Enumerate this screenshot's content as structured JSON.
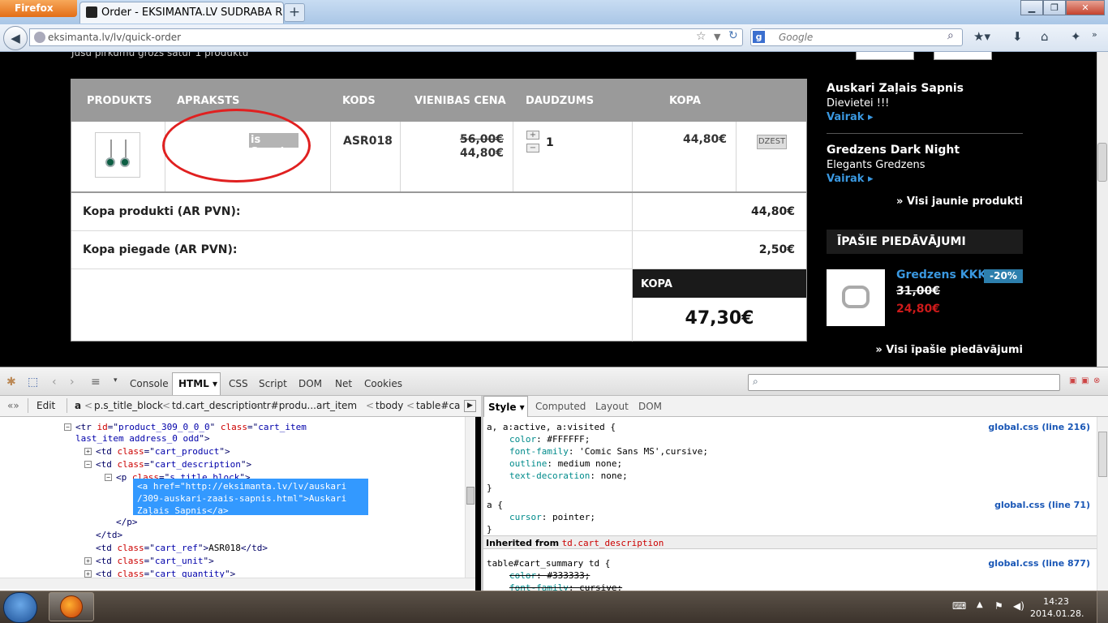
{
  "browser": {
    "menu_label": "Firefox",
    "tab_title": "Order - EKSIMANTA.LV SUDRABA ROTAS",
    "new_tab": "+",
    "url": "eksimanta.lv/lv/quick-order",
    "search_placeholder": "Google",
    "search_engine_badge": "g"
  },
  "page": {
    "top_message": "Jūsu pirkumu grozs satur 1 produktu",
    "cart": {
      "headers": [
        "PRODUKTS",
        "APRAKSTS",
        "KODS",
        "VIENIBAS CENA",
        "DAUDZUMS",
        "KOPA"
      ],
      "item": {
        "description_visible": "is Sapnis",
        "code": "ASR018",
        "old_price": "56,00€",
        "unit_price": "44,80€",
        "quantity": "1",
        "total": "44,80€",
        "delete_label": "DZEST",
        "plus": "+",
        "minus": "−"
      },
      "summary": [
        {
          "label": "Kopa produkti (AR PVN):",
          "value": "44,80€"
        },
        {
          "label": "Kopa piegade (AR PVN):",
          "value": "2,50€"
        }
      ],
      "grand_label": "KOPA",
      "grand_total": "47,30€"
    },
    "sidebar": {
      "products": [
        {
          "name": "Auskari Zaļais Sapnis",
          "desc": "Dievietei !!!",
          "more": "Vairak"
        },
        {
          "name": "Gredzens Dark Night",
          "desc": "Elegants Gredzens",
          "more": "Vairak"
        }
      ],
      "new_link": "» Visi jaunie produkti",
      "special_title": "ĪPAŠIE PIEDĀVĀJUMI",
      "special_item": {
        "name": "Gredzens KKK",
        "discount": "-20%",
        "old_price": "31,00€",
        "new_price": "24,80€"
      },
      "special_link": "» Visi īpašie piedāvājumi"
    }
  },
  "firebug": {
    "tabs": [
      "Console",
      "HTML",
      "CSS",
      "Script",
      "DOM",
      "Net",
      "Cookies"
    ],
    "edit_label": "Edit",
    "breadcrumb": [
      "a",
      "p.s_title_block",
      "td.cart_description",
      "tr#produ...art_item",
      "tbody",
      "table#ca"
    ],
    "html_lines": [
      {
        "indent": 93,
        "parts": [
          [
            "tg",
            "<tr "
          ],
          [
            "an",
            "id"
          ],
          [
            "tg",
            "=\""
          ],
          [
            "av",
            "product_309_0_0_0"
          ],
          [
            "tg",
            "\" "
          ],
          [
            "an",
            "class"
          ],
          [
            "tg",
            "=\""
          ],
          [
            "av",
            "cart_item"
          ]
        ]
      },
      {
        "indent": 93,
        "parts": [
          [
            "av",
            "last_item address_0 odd"
          ],
          [
            "tg",
            "\">"
          ]
        ]
      },
      {
        "indent": 118,
        "parts": [
          [
            "tg",
            "<td "
          ],
          [
            "an",
            "class"
          ],
          [
            "tg",
            "=\""
          ],
          [
            "av",
            "cart_product"
          ],
          [
            "tg",
            "\">"
          ]
        ]
      },
      {
        "indent": 118,
        "parts": [
          [
            "tg",
            "<td "
          ],
          [
            "an",
            "class"
          ],
          [
            "tg",
            "=\""
          ],
          [
            "av",
            "cart_description"
          ],
          [
            "tg",
            "\">"
          ]
        ]
      },
      {
        "indent": 143,
        "parts": [
          [
            "tg",
            "<p "
          ],
          [
            "an",
            "class"
          ],
          [
            "tg",
            "=\""
          ],
          [
            "av",
            "s_title_block"
          ],
          [
            "tg",
            "\">"
          ]
        ]
      },
      {
        "indent": 143,
        "parts": [
          [
            "tg",
            "</p>"
          ]
        ]
      },
      {
        "indent": 118,
        "parts": [
          [
            "tg",
            "</td>"
          ]
        ]
      },
      {
        "indent": 118,
        "parts": [
          [
            "tg",
            "<td "
          ],
          [
            "an",
            "class"
          ],
          [
            "tg",
            "=\""
          ],
          [
            "av",
            "cart_ref"
          ],
          [
            "tg",
            "\">"
          ],
          [
            "pv",
            "ASR018"
          ],
          [
            "tg",
            "</td>"
          ]
        ]
      },
      {
        "indent": 118,
        "parts": [
          [
            "tg",
            "<td "
          ],
          [
            "an",
            "class"
          ],
          [
            "tg",
            "=\""
          ],
          [
            "av",
            "cart_unit"
          ],
          [
            "tg",
            "\">"
          ]
        ]
      },
      {
        "indent": 118,
        "parts": [
          [
            "tg",
            "<td "
          ],
          [
            "an",
            "class"
          ],
          [
            "tg",
            "=\""
          ],
          [
            "av",
            "cart_quantity"
          ],
          [
            "tg",
            "\">"
          ]
        ]
      }
    ],
    "selected_node": [
      "<a href=\"http://eksimanta.lv/lv/auskari",
      "/309-auskari-zaais-sapnis.html\">Auskari",
      "Zaļais Sapnis</a>"
    ],
    "right_tabs": [
      "Style",
      "Computed",
      "Layout",
      "DOM"
    ],
    "css_rules": [
      {
        "selector": "a, a:active, a:visited {",
        "source": "global.css (line 216)",
        "props": [
          [
            "color",
            "#FFFFFF;"
          ],
          [
            "font-family",
            "'Comic Sans MS',cursive;"
          ],
          [
            "outline",
            "medium none;"
          ],
          [
            "text-decoration",
            "none;"
          ]
        ]
      },
      {
        "selector": "a {",
        "source": "global.css (line 71)",
        "props": [
          [
            "cursor",
            "pointer;"
          ]
        ]
      }
    ],
    "inherited_label": "Inherited from",
    "inherited_from": "td.cart_description",
    "inherited_rule": {
      "selector": "table#cart_summary td {",
      "source": "global.css (line 877)",
      "props": [
        [
          "color",
          "#333333;"
        ],
        [
          "font-family",
          "cursive;"
        ]
      ]
    }
  },
  "taskbar": {
    "time": "14:23",
    "date": "2014.01.28."
  },
  "colors": {
    "accent_link": "#3a98e0",
    "discount": "#2d7fad",
    "sale_price": "#cc1a1a",
    "annotation_circle": "#e02020",
    "selection": "#3399ff"
  },
  "icons": [
    "firefox-logo-icon",
    "star-icon",
    "reload-icon",
    "search-icon",
    "bookmarks-icon",
    "download-icon",
    "home-icon",
    "addon-icon",
    "windows-start-icon"
  ]
}
